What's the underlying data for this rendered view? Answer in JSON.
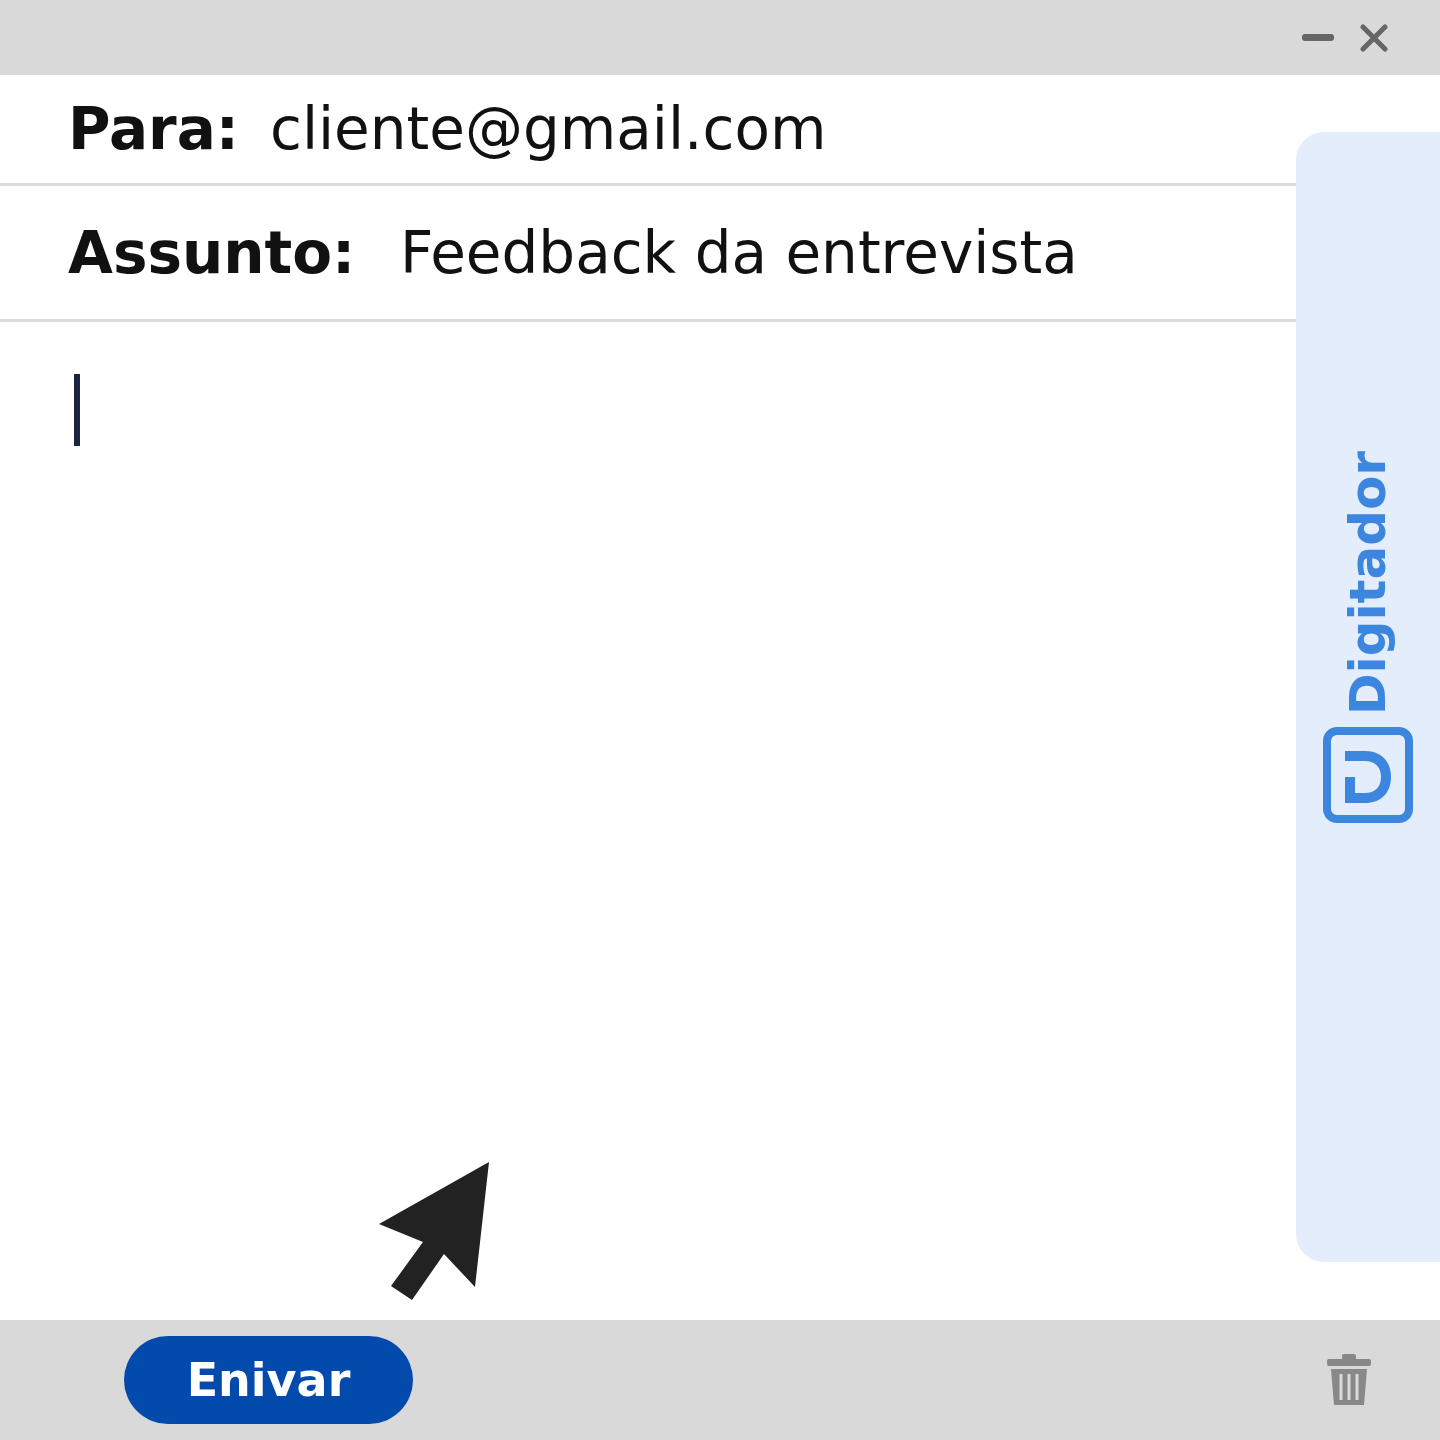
{
  "compose": {
    "to": {
      "label": "Para:",
      "value": "cliente@gmail.com"
    },
    "subject": {
      "label": "Assunto:",
      "value": "Feedback da entrevista"
    },
    "body": {
      "focused": true
    }
  },
  "side_panel": {
    "brand": "Digitador"
  },
  "footer": {
    "send_button": "Enivar"
  }
}
